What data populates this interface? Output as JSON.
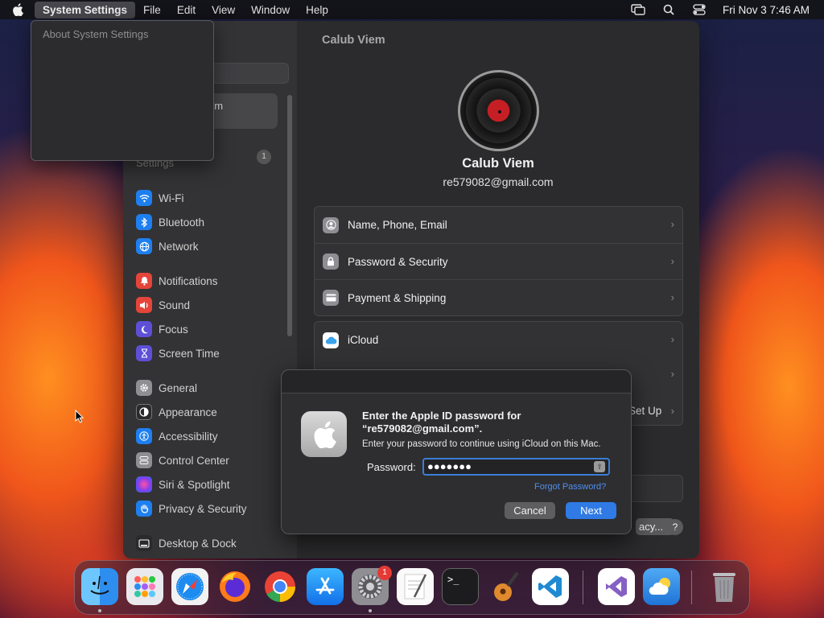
{
  "menubar": {
    "app_name": "System Settings",
    "items": [
      "File",
      "Edit",
      "View",
      "Window",
      "Help"
    ],
    "clock": "Fri Nov 3  7:46 AM"
  },
  "dropdown": {
    "item": "About System Settings"
  },
  "sidebar": {
    "selected_partial": "em",
    "settings_partial": "Settings",
    "badge": "1",
    "items": [
      {
        "label": "Wi-Fi",
        "icon": "wifi-icon",
        "color": "#1e7ff0"
      },
      {
        "label": "Bluetooth",
        "icon": "bluetooth-icon",
        "color": "#1e7ff0"
      },
      {
        "label": "Network",
        "icon": "globe-icon",
        "color": "#1e7ff0"
      },
      {
        "label": "Notifications",
        "icon": "bell-icon",
        "color": "#e5443a"
      },
      {
        "label": "Sound",
        "icon": "speaker-icon",
        "color": "#e5443a"
      },
      {
        "label": "Focus",
        "icon": "moon-icon",
        "color": "#5e4fd6"
      },
      {
        "label": "Screen Time",
        "icon": "hourglass-icon",
        "color": "#5e4fd6"
      },
      {
        "label": "General",
        "icon": "gear-icon",
        "color": "#8e8e93"
      },
      {
        "label": "Appearance",
        "icon": "appearance-icon",
        "color": "#2a2a2c"
      },
      {
        "label": "Accessibility",
        "icon": "accessibility-icon",
        "color": "#1e7ff0"
      },
      {
        "label": "Control Center",
        "icon": "control-center-icon",
        "color": "#8e8e93"
      },
      {
        "label": "Siri & Spotlight",
        "icon": "siri-icon",
        "color": "#c83fd1"
      },
      {
        "label": "Privacy & Security",
        "icon": "hand-icon",
        "color": "#1e7ff0"
      },
      {
        "label": "Desktop & Dock",
        "icon": "dock-icon",
        "color": "#2a2a2c"
      }
    ]
  },
  "content": {
    "title": "Calub Viem",
    "user_name": "Calub Viem",
    "user_email": "re579082@gmail.com",
    "group1": [
      {
        "label": "Name, Phone, Email",
        "icon": "person-icon"
      },
      {
        "label": "Password & Security",
        "icon": "lock-icon"
      },
      {
        "label": "Payment & Shipping",
        "icon": "card-icon"
      }
    ],
    "group2": [
      {
        "label": "iCloud",
        "icon": "icloud-icon"
      }
    ],
    "setup_partial": "Set Up",
    "policy_partial": "acy...",
    "help": "?"
  },
  "dialog": {
    "title_line1": "Enter the Apple ID password for",
    "title_line2": "“re579082@gmail.com”.",
    "subtitle": "Enter your password to continue using iCloud on this Mac.",
    "password_label": "Password:",
    "password_value": "●●●●●●●",
    "forgot": "Forgot Password?",
    "cancel": "Cancel",
    "next": "Next"
  },
  "dock": {
    "apps": [
      {
        "name": "Finder",
        "icon": "finder-icon"
      },
      {
        "name": "Launchpad",
        "icon": "launchpad-icon"
      },
      {
        "name": "Safari",
        "icon": "safari-icon"
      },
      {
        "name": "Firefox",
        "icon": "firefox-icon"
      },
      {
        "name": "Chrome",
        "icon": "chrome-icon"
      },
      {
        "name": "App Store",
        "icon": "app-store-icon"
      },
      {
        "name": "System Settings",
        "icon": "system-settings-icon"
      },
      {
        "name": "TextEdit",
        "icon": "textedit-icon"
      },
      {
        "name": "Terminal",
        "icon": "terminal-icon"
      },
      {
        "name": "GarageBand",
        "icon": "garageband-icon"
      },
      {
        "name": "VS Code",
        "icon": "vscode-icon"
      },
      {
        "name": "Visual Studio",
        "icon": "visual-studio-icon"
      },
      {
        "name": "Weather",
        "icon": "weather-icon"
      },
      {
        "name": "Trash",
        "icon": "trash-icon"
      }
    ],
    "settings_badge": "1",
    "terminal_prompt": ">_"
  }
}
